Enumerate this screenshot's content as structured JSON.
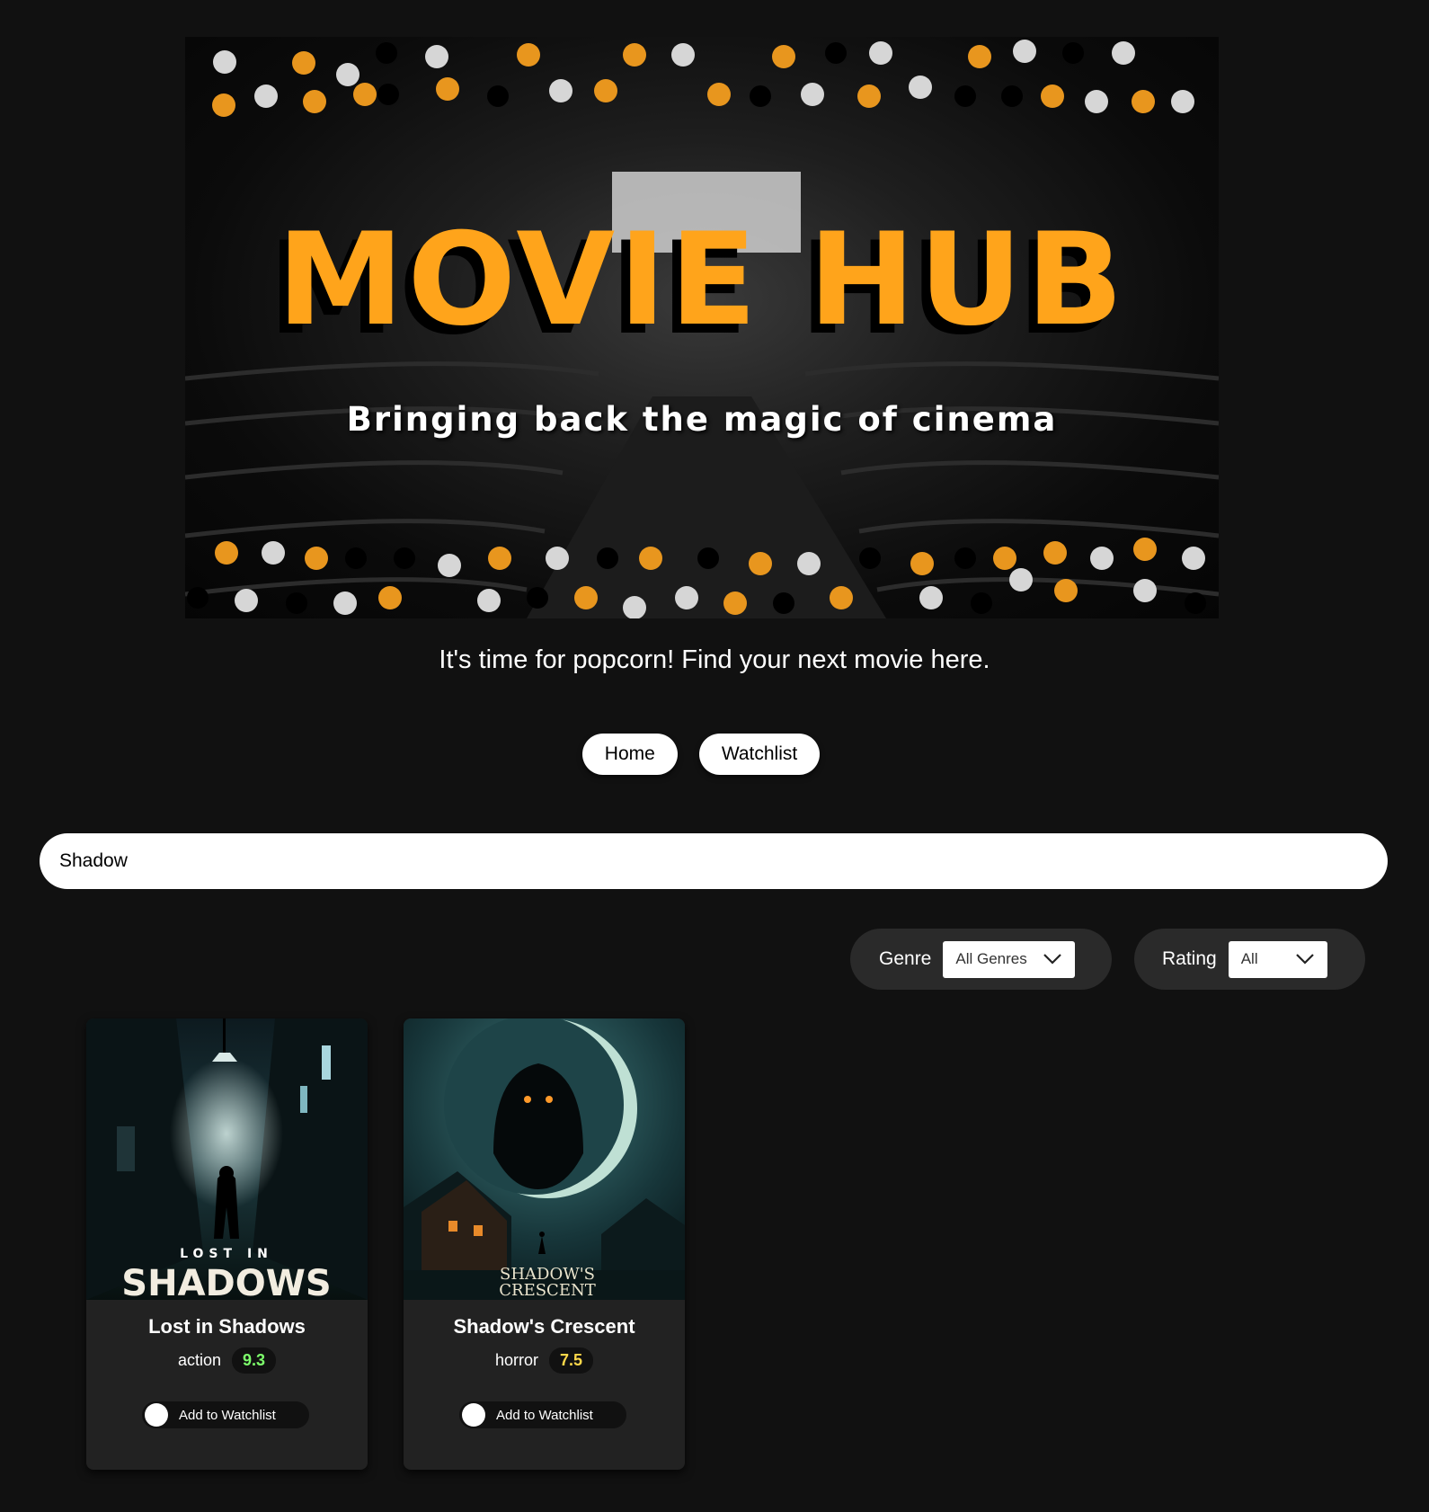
{
  "hero": {
    "title": "MOVIE HUB",
    "subtitle": "Bringing back the magic of cinema"
  },
  "tagline": "It's time for popcorn! Find your next movie here.",
  "nav": {
    "home_label": "Home",
    "watchlist_label": "Watchlist"
  },
  "search": {
    "value": "Shadow"
  },
  "filters": {
    "genre_label": "Genre",
    "genre_selected": "All Genres",
    "rating_label": "Rating",
    "rating_selected": "All"
  },
  "movies": [
    {
      "title": "Lost in Shadows",
      "poster_line1": "LOST IN",
      "poster_line2": "SHADOWS",
      "genre": "action",
      "rating": "9.3",
      "rating_color": "#7dff6b",
      "watchlist_label": "Add to Watchlist"
    },
    {
      "title": "Shadow's Crescent",
      "poster_line1": "SHADOW'S",
      "poster_line2": "CRESCENT",
      "genre": "horror",
      "rating": "7.5",
      "rating_color": "#ffd84a",
      "watchlist_label": "Add to Watchlist"
    }
  ],
  "colors": {
    "background": "#111111",
    "accent": "#ffa41b",
    "card": "#222222"
  }
}
